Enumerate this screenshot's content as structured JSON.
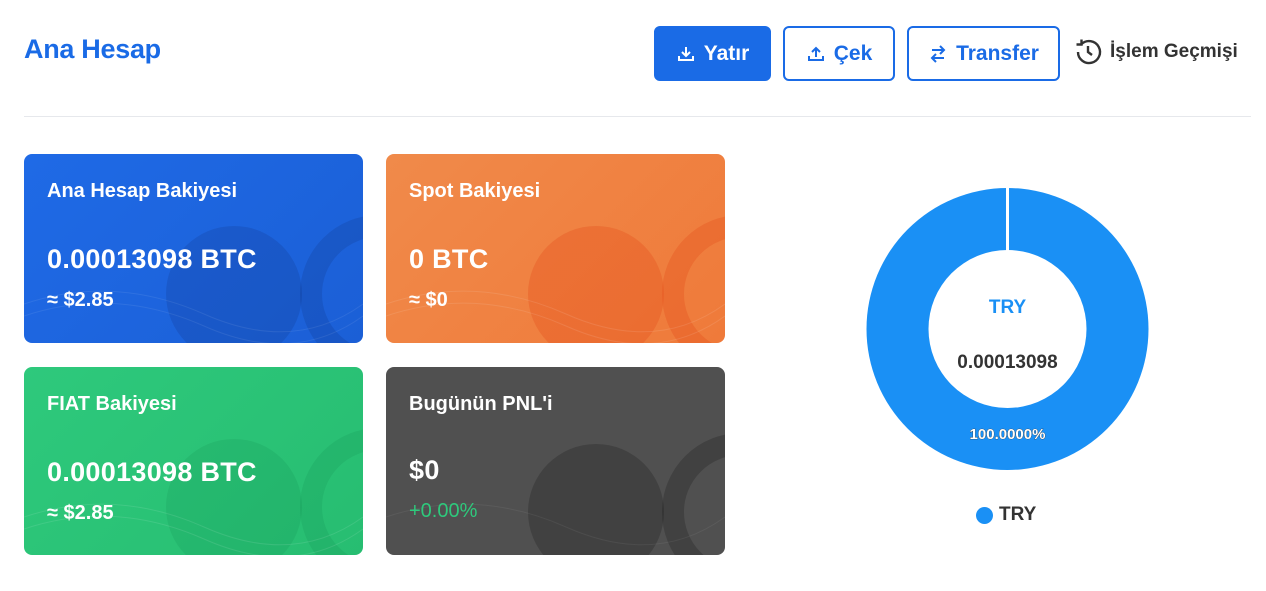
{
  "header": {
    "title": "Ana Hesap",
    "deposit_label": "Yatır",
    "withdraw_label": "Çek",
    "transfer_label": "Transfer",
    "history_label": "İşlem Geçmişi"
  },
  "cards": {
    "main": {
      "label": "Ana Hesap Bakiyesi",
      "amount": "0.00013098 BTC",
      "usd": "≈ $2.85",
      "color": "#1f6ae6"
    },
    "spot": {
      "label": "Spot Bakiyesi",
      "amount": "0 BTC",
      "usd": "≈ $0",
      "color": "#f08a4a"
    },
    "fiat": {
      "label": "FIAT Bakiyesi",
      "amount": "0.00013098 BTC",
      "usd": "≈ $2.85",
      "color": "#2ec97c"
    },
    "pnl": {
      "label": "Bugünün PNL'i",
      "amount": "$0",
      "change": "+0.00%",
      "color": "#505050",
      "change_color": "#2ec97c"
    }
  },
  "chart_data": {
    "type": "pie",
    "categories": [
      "TRY"
    ],
    "values": [
      100
    ],
    "center_label": "TRY",
    "center_value": "0.00013098",
    "slice_labels": [
      "100.0000%"
    ],
    "legend": [
      "TRY"
    ],
    "colors": [
      "#1a90f5"
    ],
    "legend_position": "bottom"
  },
  "colors": {
    "accent": "#1a6be6"
  }
}
